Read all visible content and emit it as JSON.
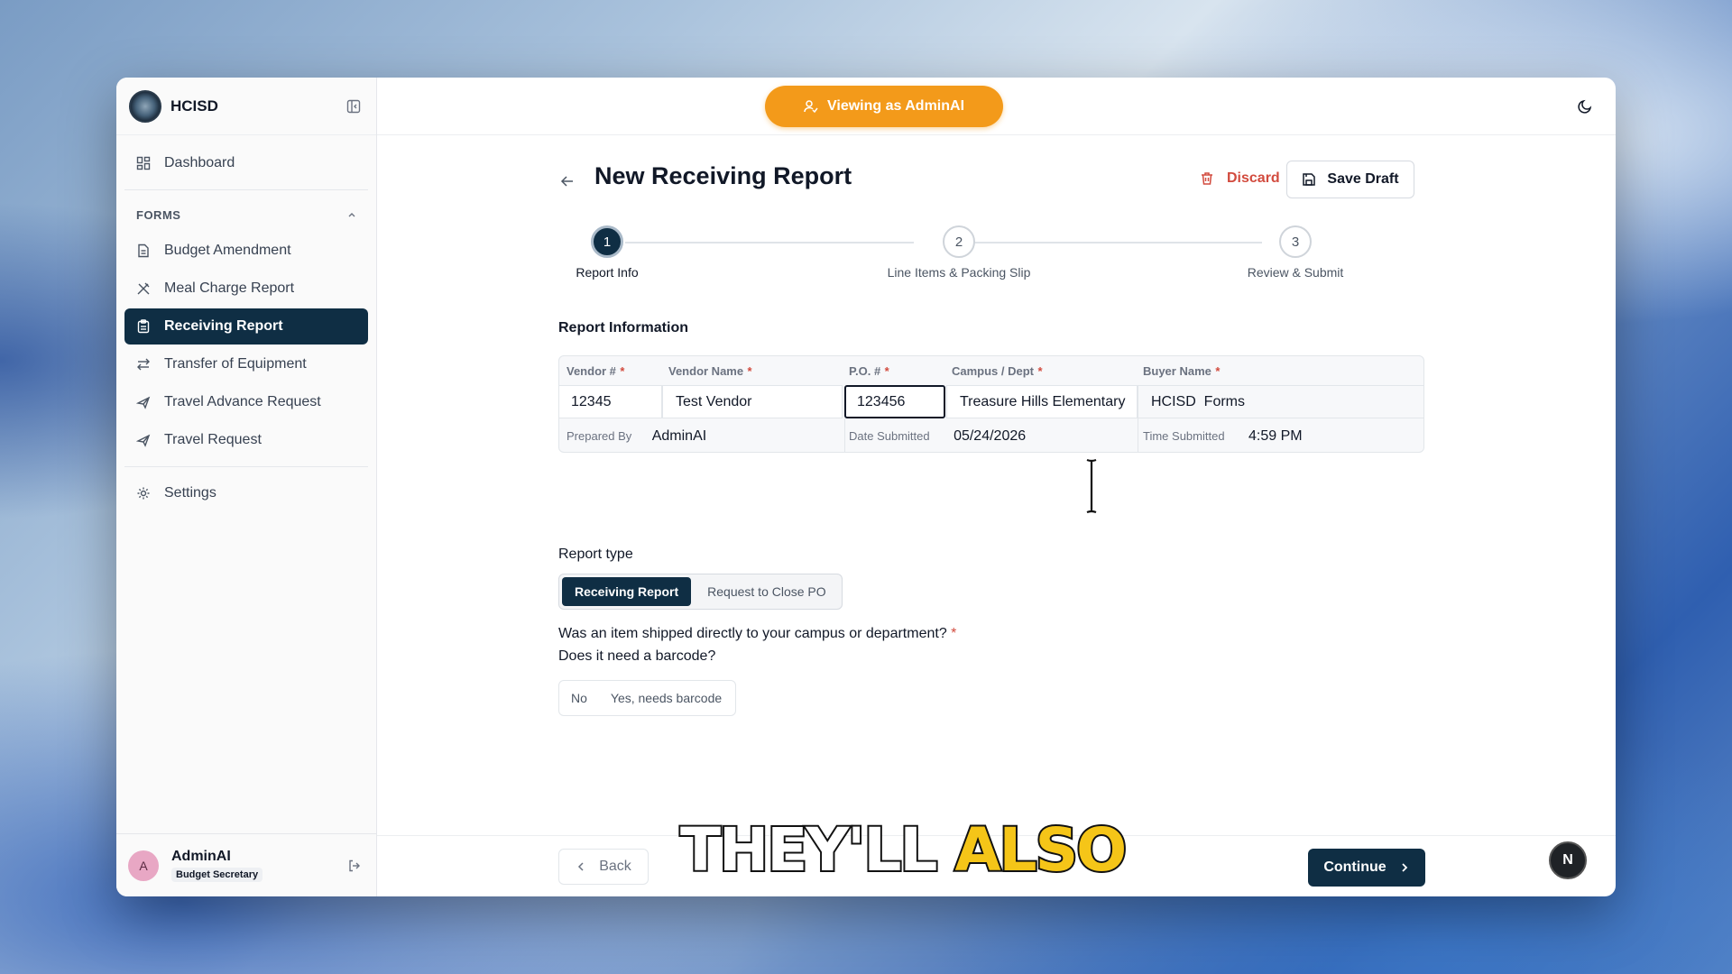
{
  "app": {
    "brand": "HCISD",
    "viewing_as": "Viewing as AdminAI"
  },
  "sidebar": {
    "dashboard": "Dashboard",
    "forms_section": "FORMS",
    "items": [
      {
        "label": "Budget Amendment",
        "icon": "file-text-icon"
      },
      {
        "label": "Meal Charge Report",
        "icon": "utensils-crossed-icon"
      },
      {
        "label": "Receiving Report",
        "icon": "clipboard-icon",
        "active": true
      },
      {
        "label": "Transfer of Equipment",
        "icon": "arrows-swap-icon"
      },
      {
        "label": "Travel Advance Request",
        "icon": "plane-icon"
      },
      {
        "label": "Travel Request",
        "icon": "plane-icon"
      }
    ],
    "settings": "Settings"
  },
  "user": {
    "initial": "A",
    "name": "AdminAI",
    "role": "Budget Secretary"
  },
  "page": {
    "title": "New Receiving Report",
    "discard": "Discard",
    "save_draft": "Save Draft"
  },
  "stepper": {
    "steps": [
      {
        "number": "1",
        "label": "Report Info",
        "current": true
      },
      {
        "number": "2",
        "label": "Line Items & Packing Slip"
      },
      {
        "number": "3",
        "label": "Review & Submit"
      }
    ]
  },
  "report_info": {
    "title": "Report Information",
    "vendor_num_label": "Vendor #",
    "vendor_num": "12345",
    "vendor_name_label": "Vendor Name",
    "vendor_name": "Test Vendor",
    "po_label": "P.O. #",
    "po": "123456",
    "campus_label": "Campus / Dept",
    "campus": "Treasure Hills Elementary",
    "buyer_label": "Buyer Name",
    "buyer": "HCISD  Forms",
    "required_mark": "*",
    "prepared_by_label": "Prepared By",
    "prepared_by": "AdminAI",
    "date_submitted_label": "Date Submitted",
    "date_submitted": "05/24/2026",
    "time_submitted_label": "Time Submitted",
    "time_submitted": "4:59 PM"
  },
  "report_type": {
    "title": "Report type",
    "options": [
      "Receiving Report",
      "Request to Close PO"
    ],
    "selected": "Receiving Report"
  },
  "shipping_question": {
    "question": "Was an item shipped directly to your campus or department?",
    "required_mark": "*",
    "subquestion": "Does it need a barcode?",
    "options": [
      "No",
      "Yes, needs barcode"
    ]
  },
  "footer": {
    "back": "Back",
    "continue": "Continue",
    "badge": "N"
  },
  "caption": {
    "white": "THEY'LL",
    "yellow": "ALSO"
  },
  "colors": {
    "primary": "#0f2e44",
    "accent_orange": "#f39a1a",
    "danger": "#d24b3e"
  }
}
